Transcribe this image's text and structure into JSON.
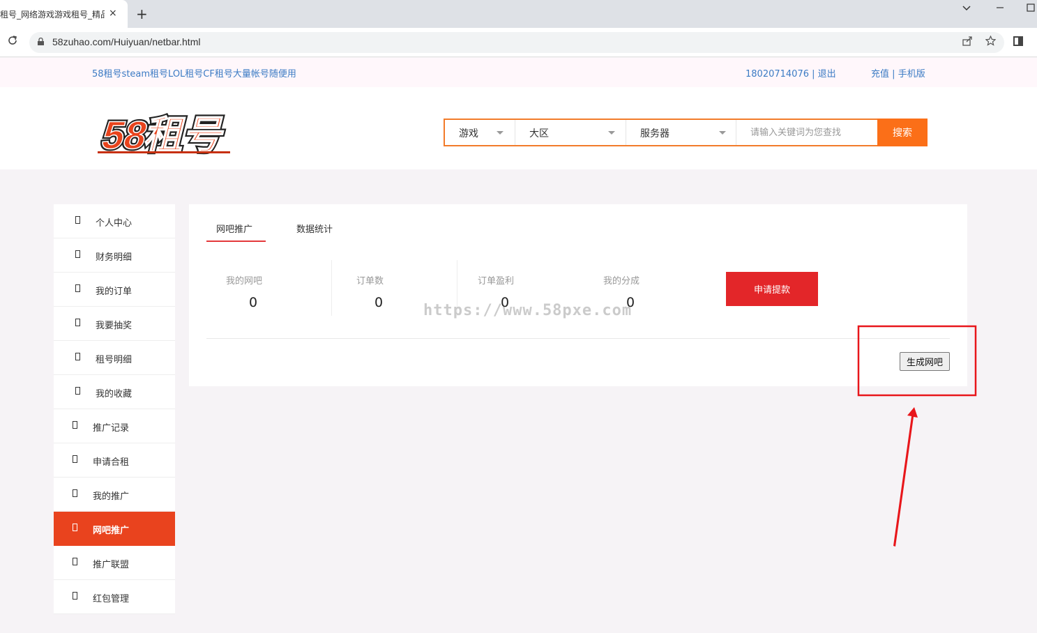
{
  "browser": {
    "tab_title": "租号_网络游戏游戏租号_精品",
    "tab_close": "×",
    "new_tab": "+",
    "url": "58zuhao.com/Huiyuan/netbar.html"
  },
  "topnav": {
    "slogan": "58租号steam租号LOL租号CF租号大量帐号随便用",
    "phone": "18020714076",
    "sep1": "|",
    "logout": "退出",
    "recharge": "充值",
    "sep2": "|",
    "mobile": "手机版"
  },
  "logo": {
    "text": "58租号"
  },
  "search": {
    "game": "游戏",
    "region": "大区",
    "server": "服务器",
    "placeholder": "请输入关键词为您查找",
    "button": "搜索"
  },
  "sidebar": {
    "items": [
      {
        "label": "个人中心"
      },
      {
        "label": "财务明细"
      },
      {
        "label": "我的订单"
      },
      {
        "label": "我要抽奖"
      },
      {
        "label": "租号明细"
      },
      {
        "label": "我的收藏"
      },
      {
        "label": "推广记录"
      },
      {
        "label": "申请合租"
      },
      {
        "label": "我的推广"
      },
      {
        "label": "网吧推广"
      },
      {
        "label": "推广联盟"
      },
      {
        "label": "红包管理"
      }
    ]
  },
  "main": {
    "tabs": [
      {
        "label": "网吧推广"
      },
      {
        "label": "数据统计"
      }
    ],
    "stats": [
      {
        "label": "我的网吧",
        "value": "0"
      },
      {
        "label": "订单数",
        "value": "0"
      },
      {
        "label": "订单盈利",
        "value": "0"
      },
      {
        "label": "我的分成",
        "value": "0"
      }
    ],
    "apply_button": "申请提款",
    "generate_button": "生成网吧"
  },
  "watermark": "https://www.58pxe.com",
  "colors": {
    "accent_orange": "#fb6f18",
    "sidebar_active": "#e9431e",
    "apply_red": "#e32629",
    "link_blue": "#3b7bc4",
    "annotation_red": "#e8161b"
  }
}
